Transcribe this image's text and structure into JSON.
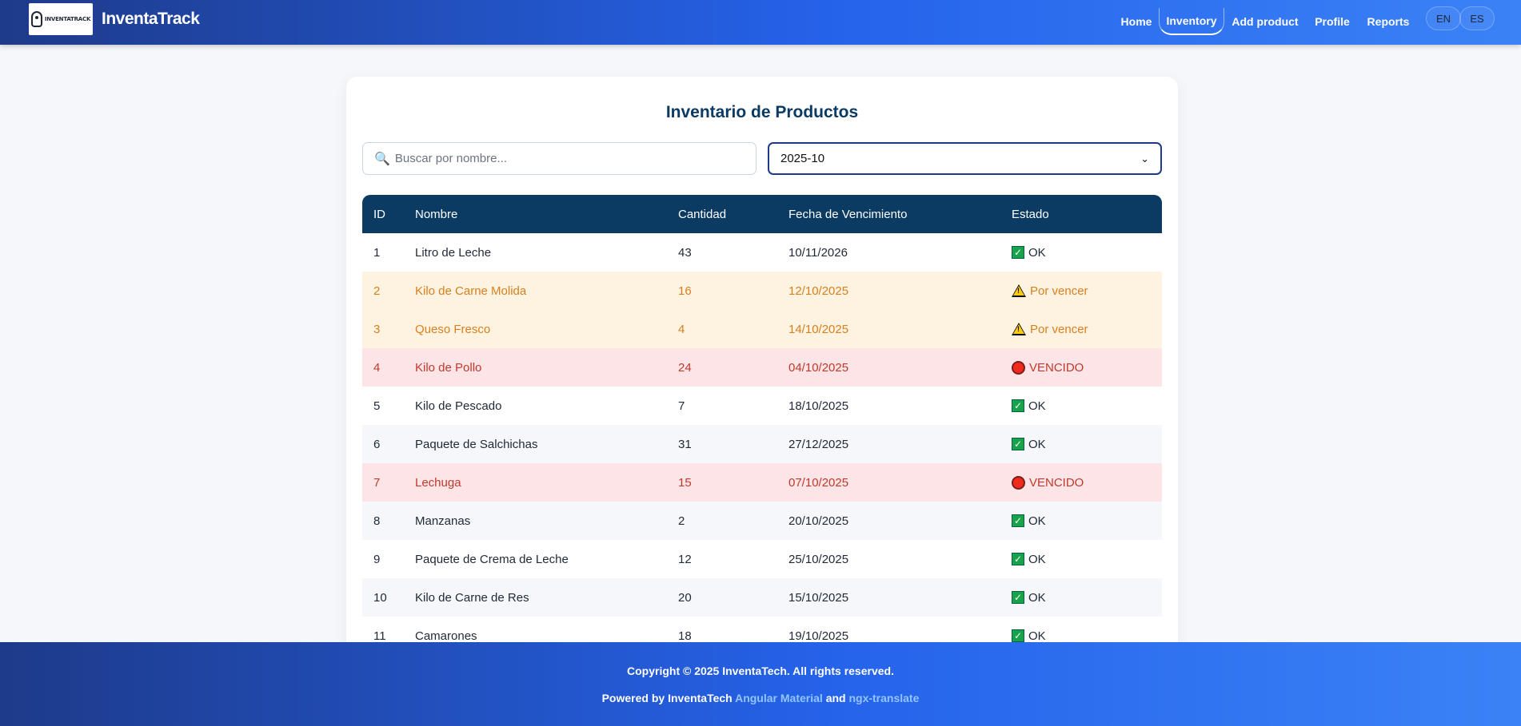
{
  "header": {
    "logo_text": "INVENTATRACK",
    "brand": "InventaTrack",
    "nav": [
      "Home",
      "Inventory",
      "Add product",
      "Profile",
      "Reports"
    ],
    "active_nav": "Inventory",
    "languages": [
      "EN",
      "ES"
    ]
  },
  "main": {
    "title": "Inventario de Productos",
    "search_placeholder": "Buscar por nombre...",
    "month_value": "2025-10",
    "columns": [
      "ID",
      "Nombre",
      "Cantidad",
      "Fecha de Vencimiento",
      "Estado"
    ],
    "rows": [
      {
        "id": "1",
        "name": "Litro de Leche",
        "qty": "43",
        "date": "10/11/2026",
        "status": "OK",
        "kind": "ok"
      },
      {
        "id": "2",
        "name": "Kilo de Carne Molida",
        "qty": "16",
        "date": "12/10/2025",
        "status": "Por vencer",
        "kind": "warn"
      },
      {
        "id": "3",
        "name": "Queso Fresco",
        "qty": "4",
        "date": "14/10/2025",
        "status": "Por vencer",
        "kind": "warn"
      },
      {
        "id": "4",
        "name": "Kilo de Pollo",
        "qty": "24",
        "date": "04/10/2025",
        "status": "VENCIDO",
        "kind": "expired"
      },
      {
        "id": "5",
        "name": "Kilo de Pescado",
        "qty": "7",
        "date": "18/10/2025",
        "status": "OK",
        "kind": "ok"
      },
      {
        "id": "6",
        "name": "Paquete de Salchichas",
        "qty": "31",
        "date": "27/12/2025",
        "status": "OK",
        "kind": "ok"
      },
      {
        "id": "7",
        "name": "Lechuga",
        "qty": "15",
        "date": "07/10/2025",
        "status": "VENCIDO",
        "kind": "expired"
      },
      {
        "id": "8",
        "name": "Manzanas",
        "qty": "2",
        "date": "20/10/2025",
        "status": "OK",
        "kind": "ok"
      },
      {
        "id": "9",
        "name": "Paquete de Crema de Leche",
        "qty": "12",
        "date": "25/10/2025",
        "status": "OK",
        "kind": "ok"
      },
      {
        "id": "10",
        "name": "Kilo de Carne de Res",
        "qty": "20",
        "date": "15/10/2025",
        "status": "OK",
        "kind": "ok"
      },
      {
        "id": "11",
        "name": "Camarones",
        "qty": "18",
        "date": "19/10/2025",
        "status": "OK",
        "kind": "ok"
      }
    ]
  },
  "footer": {
    "copyright": "Copyright © 2025 InventaTech. All rights reserved.",
    "powered_prefix": "Powered by InventaTech",
    "link1": "Angular Material",
    "and": "and",
    "link2": "ngx-translate"
  },
  "colors": {
    "header_gradient_start": "#1e3a8a",
    "header_gradient_end": "#3b82f6",
    "table_header": "#0b3a63",
    "warn_row": "#fef3e1",
    "warn_text": "#d97f1c",
    "expired_row": "#fde5e7",
    "expired_text": "#c0392b",
    "ok_icon": "#16a34a"
  },
  "icons": {
    "search": "magnifier-icon",
    "ok": "check-box-icon",
    "warn": "warning-triangle-icon",
    "expired": "red-circle-icon"
  }
}
